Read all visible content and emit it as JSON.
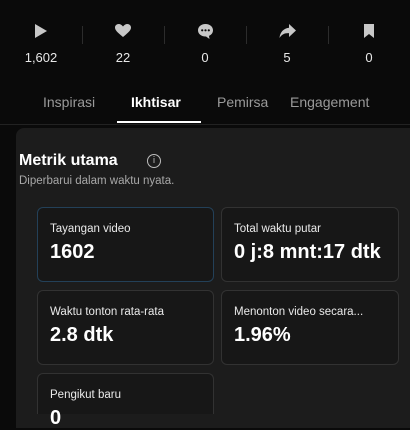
{
  "stats": [
    {
      "icon": "play-icon",
      "value": "1,602"
    },
    {
      "icon": "heart-icon",
      "value": "22"
    },
    {
      "icon": "comment-icon",
      "value": "0"
    },
    {
      "icon": "share-icon",
      "value": "5"
    },
    {
      "icon": "bookmark-icon",
      "value": "0"
    }
  ],
  "tabs": [
    {
      "label": "Inspirasi",
      "active": false
    },
    {
      "label": "Ikhtisar",
      "active": true
    },
    {
      "label": "Pemirsa",
      "active": false
    },
    {
      "label": "Engagement",
      "active": false
    }
  ],
  "section": {
    "title": "Metrik utama",
    "info_icon": "info-icon",
    "subtitle": "Diperbarui dalam waktu nyata."
  },
  "cards": [
    {
      "label": "Tayangan video",
      "value": "1602",
      "selected": true
    },
    {
      "label": "Total waktu putar",
      "value": "0 j:8 mnt:17 dtk",
      "selected": false
    },
    {
      "label": "Waktu tonton rata-rata",
      "value": "2.8 dtk",
      "selected": false
    },
    {
      "label": "Menonton video secara...",
      "value": "1.96%",
      "selected": false
    },
    {
      "label": "Pengikut baru",
      "value": "0",
      "selected": false
    }
  ],
  "colors": {
    "background": "#0a0a0a",
    "panel": "#1c1c1c",
    "selected_border": "#234058"
  }
}
